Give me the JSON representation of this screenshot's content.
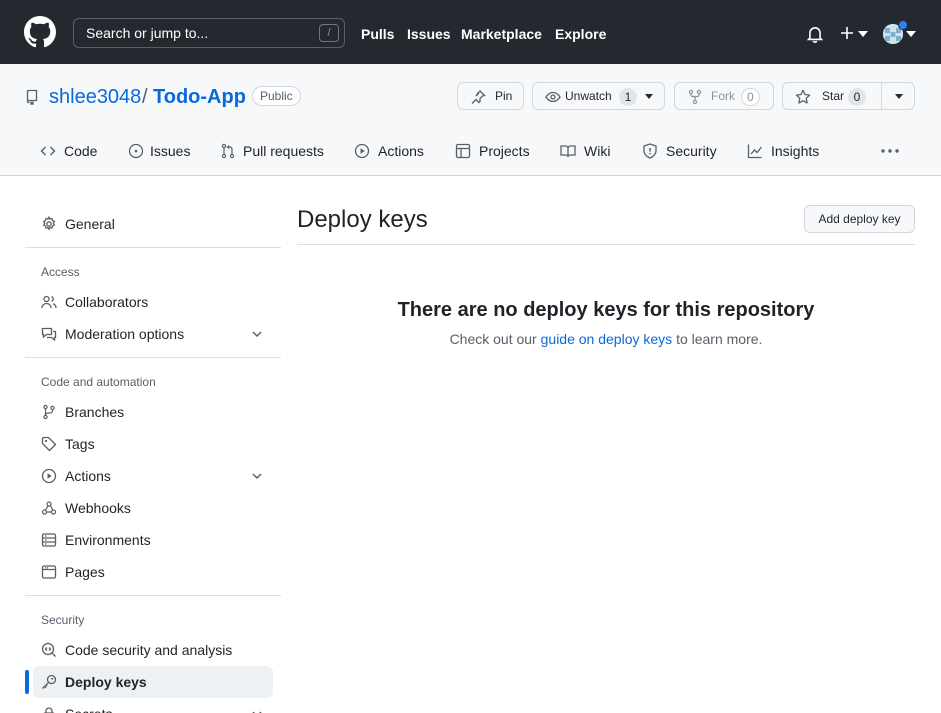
{
  "header": {
    "search_placeholder": "Search or jump to...",
    "search_shortcut": "/",
    "nav": [
      "Pulls",
      "Issues",
      "Marketplace",
      "Explore"
    ],
    "icons": [
      "github-logo",
      "bell-icon",
      "plus-icon",
      "avatar"
    ]
  },
  "repo": {
    "owner": "shlee3048",
    "separator": "/",
    "name": "Todo-App",
    "visibility": "Public",
    "actions": {
      "pin": "Pin",
      "unwatch": "Unwatch",
      "watch_count": "1",
      "fork": "Fork",
      "fork_count": "0",
      "star": "Star",
      "star_count": "0"
    },
    "tabs": [
      {
        "label": "Code",
        "icon": "code-icon"
      },
      {
        "label": "Issues",
        "icon": "issue-icon"
      },
      {
        "label": "Pull requests",
        "icon": "pull-request-icon"
      },
      {
        "label": "Actions",
        "icon": "play-icon"
      },
      {
        "label": "Projects",
        "icon": "table-icon"
      },
      {
        "label": "Wiki",
        "icon": "book-icon"
      },
      {
        "label": "Security",
        "icon": "shield-icon"
      },
      {
        "label": "Insights",
        "icon": "graph-icon"
      }
    ]
  },
  "sidebar": {
    "general": "General",
    "access_heading": "Access",
    "collaborators": "Collaborators",
    "moderation": "Moderation options",
    "code_heading": "Code and automation",
    "branches": "Branches",
    "tags": "Tags",
    "actions": "Actions",
    "webhooks": "Webhooks",
    "environments": "Environments",
    "pages": "Pages",
    "security_heading": "Security",
    "code_security": "Code security and analysis",
    "deploy_keys": "Deploy keys",
    "secrets": "Secrets"
  },
  "main": {
    "title": "Deploy keys",
    "add_button": "Add deploy key",
    "blank_title": "There are no deploy keys for this repository",
    "blank_prefix": "Check out our",
    "blank_link": "guide on deploy keys",
    "blank_suffix": "to learn more."
  },
  "colors": {
    "header_bg": "#24292f",
    "link": "#0969da",
    "accent": "#0969da",
    "repo_bg": "#f6f8fa"
  }
}
